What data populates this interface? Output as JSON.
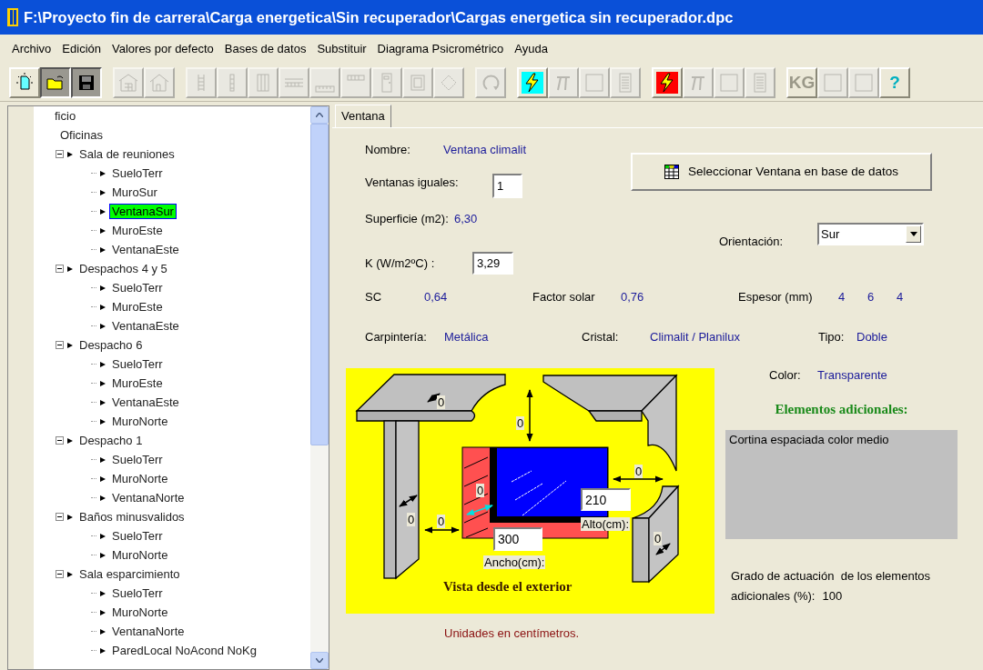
{
  "window": {
    "title": "F:\\Proyecto fin de carrera\\Carga energetica\\Sin recuperador\\Cargas energetica sin recuperador.dpc"
  },
  "menu": [
    "Archivo",
    "Edición",
    "Valores por defecto",
    "Bases de datos",
    "Substituir",
    "Diagrama Psicrométrico",
    "Ayuda"
  ],
  "toolbar": [
    [
      {
        "kind": "new",
        "disabled": false,
        "pressed": false
      },
      {
        "kind": "open",
        "disabled": false,
        "pressed": true
      },
      {
        "kind": "save",
        "disabled": false,
        "pressed": true
      }
    ],
    [
      {
        "kind": "building",
        "disabled": true,
        "pressed": false
      },
      {
        "kind": "house",
        "disabled": true,
        "pressed": false
      }
    ],
    [
      {
        "kind": "ladder",
        "disabled": true,
        "pressed": false
      },
      {
        "kind": "column",
        "disabled": true,
        "pressed": false
      },
      {
        "kind": "double-column",
        "disabled": true,
        "pressed": false
      },
      {
        "kind": "beam",
        "disabled": true,
        "pressed": false
      },
      {
        "kind": "floor",
        "disabled": true,
        "pressed": false
      },
      {
        "kind": "lintel",
        "disabled": true,
        "pressed": false
      },
      {
        "kind": "door",
        "disabled": true,
        "pressed": false
      },
      {
        "kind": "frame",
        "disabled": true,
        "pressed": false
      },
      {
        "kind": "tile",
        "disabled": true,
        "pressed": false
      }
    ],
    [
      {
        "kind": "refresh",
        "disabled": true,
        "pressed": false
      }
    ],
    [
      {
        "kind": "bolt",
        "color": "#00ffff",
        "disabled": false,
        "pressed": false
      },
      {
        "kind": "formula",
        "disabled": true,
        "pressed": false
      },
      {
        "kind": "blank",
        "disabled": true,
        "pressed": false
      },
      {
        "kind": "report",
        "disabled": true,
        "pressed": false
      }
    ],
    [
      {
        "kind": "bolt",
        "color": "#ff0000",
        "disabled": false,
        "pressed": false
      },
      {
        "kind": "formula",
        "disabled": true,
        "pressed": false
      },
      {
        "kind": "blank",
        "disabled": true,
        "pressed": false
      },
      {
        "kind": "report",
        "disabled": true,
        "pressed": false
      }
    ],
    [
      {
        "kind": "text",
        "label": "KG",
        "disabled": true,
        "pressed": false
      },
      {
        "kind": "blank",
        "disabled": true,
        "pressed": false
      },
      {
        "kind": "blank",
        "disabled": true,
        "pressed": false
      },
      {
        "kind": "text",
        "label": "?",
        "disabled": false,
        "pressed": false
      }
    ]
  ],
  "tree": [
    {
      "label": "ficio",
      "selected": false
    },
    {
      "label": "Oficinas",
      "selected": false,
      "children": [
        {
          "label": "Sala de reuniones",
          "selected": false,
          "expanded": true,
          "children": [
            {
              "label": "SueloTerr",
              "selected": false
            },
            {
              "label": "MuroSur",
              "selected": false
            },
            {
              "label": "VentanaSur",
              "selected": true
            },
            {
              "label": "MuroEste",
              "selected": false
            },
            {
              "label": "VentanaEste",
              "selected": false
            }
          ]
        },
        {
          "label": "Despachos 4 y 5",
          "selected": false,
          "expanded": true,
          "children": [
            {
              "label": "SueloTerr",
              "selected": false
            },
            {
              "label": "MuroEste",
              "selected": false
            },
            {
              "label": "VentanaEste",
              "selected": false
            }
          ]
        },
        {
          "label": "Despacho 6",
          "selected": false,
          "expanded": true,
          "children": [
            {
              "label": "SueloTerr",
              "selected": false
            },
            {
              "label": "MuroEste",
              "selected": false
            },
            {
              "label": "VentanaEste",
              "selected": false
            },
            {
              "label": "MuroNorte",
              "selected": false
            }
          ]
        },
        {
          "label": "Despacho 1",
          "selected": false,
          "expanded": true,
          "children": [
            {
              "label": "SueloTerr",
              "selected": false
            },
            {
              "label": "MuroNorte",
              "selected": false
            },
            {
              "label": "VentanaNorte",
              "selected": false
            }
          ]
        },
        {
          "label": "Baños minusvalidos",
          "selected": false,
          "expanded": true,
          "children": [
            {
              "label": "SueloTerr",
              "selected": false
            },
            {
              "label": "MuroNorte",
              "selected": false
            }
          ]
        },
        {
          "label": "Sala esparcimiento",
          "selected": false,
          "expanded": true,
          "children": [
            {
              "label": "SueloTerr",
              "selected": false
            },
            {
              "label": "MuroNorte",
              "selected": false
            },
            {
              "label": "VentanaNorte",
              "selected": false
            },
            {
              "label": "ParedLocal NoAcond NoKg",
              "selected": false
            }
          ]
        }
      ]
    }
  ],
  "tabs": [
    {
      "label": "Ventana",
      "selected": true
    }
  ],
  "form": {
    "nombre": {
      "label": "Nombre:",
      "value": "Ventana climalit"
    },
    "ventanas_iguales": {
      "label": "Ventanas iguales:",
      "value": "1"
    },
    "select_button": "Seleccionar Ventana en base de datos",
    "superficie": {
      "label": "Superficie (m2):",
      "value": "6,30"
    },
    "orientacion": {
      "label": "Orientación:",
      "value": "Sur"
    },
    "k": {
      "label": "K (W/m2ºC) :",
      "value": "3,29"
    },
    "sc": {
      "label": "SC",
      "value": "0,64"
    },
    "factor_solar": {
      "label": "Factor solar",
      "value": "0,76"
    },
    "espesor": {
      "label": "Espesor (mm)",
      "values": [
        "4",
        "6",
        "4"
      ]
    },
    "carpinteria": {
      "label": "Carpintería:",
      "value": "Metálica"
    },
    "cristal": {
      "label": "Cristal:",
      "value": "Climalit / Planilux"
    },
    "tipo": {
      "label": "Tipo:",
      "value": "Doble"
    },
    "color": {
      "label": "Color:",
      "value": "Transparente"
    },
    "elementos_heading": "Elementos adicionales:",
    "elementos": [
      "Cortina espaciada color medio"
    ],
    "grado": {
      "label": "Grado de actuación  de los elementos adicionales (%):",
      "value": "100"
    },
    "units_note": "Unidades en centímetros."
  },
  "diagram": {
    "slab": "0",
    "pillar": "0",
    "left_gap": "0",
    "jamb": "0",
    "top_gap": "0",
    "right_gap": "0",
    "fin": "0",
    "height_value": "210",
    "height_label": "Alto(cm):",
    "width_value": "300",
    "width_label": "Ancho(cm):",
    "caption": "Vista desde el exterior"
  }
}
